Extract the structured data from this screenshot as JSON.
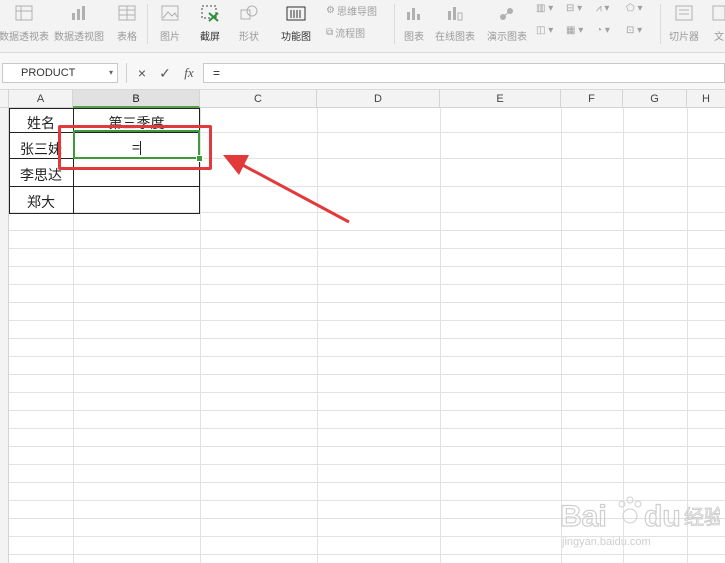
{
  "ribbon": {
    "items": [
      {
        "label": "数据透视表",
        "icon": "pivot-table-icon"
      },
      {
        "label": "数据透视图",
        "icon": "pivot-chart-icon"
      },
      {
        "label": "表格",
        "icon": "table-icon"
      },
      {
        "label": "图片",
        "icon": "picture-icon"
      },
      {
        "label": "截屏",
        "icon": "screenshot-icon"
      },
      {
        "label": "形状",
        "icon": "shapes-icon"
      },
      {
        "label": "功能图",
        "icon": "function-chart-icon"
      },
      {
        "label": "思维导图",
        "icon": "mind-map-icon"
      },
      {
        "label": "流程图",
        "icon": "flowchart-icon"
      },
      {
        "label": "图表",
        "icon": "chart-icon"
      },
      {
        "label": "在线图表",
        "icon": "online-chart-icon"
      },
      {
        "label": "演示图表",
        "icon": "presentation-chart-icon"
      },
      {
        "label": "切片器",
        "icon": "slicer-icon"
      },
      {
        "label": "文",
        "icon": "text-icon"
      }
    ]
  },
  "formula_bar": {
    "name_box": "PRODUCT",
    "cancel_symbol": "×",
    "enter_symbol": "✓",
    "fx_label": "fx",
    "content": "="
  },
  "columns": [
    "A",
    "B",
    "C",
    "D",
    "E",
    "F",
    "G",
    "H"
  ],
  "table": {
    "header": {
      "name": "姓名",
      "q3": "第三季度"
    },
    "rows": [
      {
        "name": "张三妹",
        "q3": "="
      },
      {
        "name": "李思达",
        "q3": ""
      },
      {
        "name": "郑大",
        "q3": ""
      }
    ]
  },
  "colors": {
    "active_border": "#3f9a3a",
    "annotation_red": "#e23a3a"
  },
  "watermark": {
    "brand": "Bai du 经验",
    "url": "jingyan.baidu.com"
  }
}
